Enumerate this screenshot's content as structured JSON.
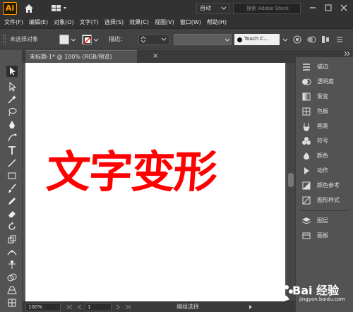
{
  "app": {
    "logo": "Ai",
    "accent": "#ff9a00"
  },
  "appbar": {
    "workspace": "自动",
    "search_placeholder": "搜索 Adobe Stock"
  },
  "menu": [
    "文件(F)",
    "编辑(E)",
    "对象(O)",
    "文字(T)",
    "选择(S)",
    "效果(C)",
    "视图(V)",
    "窗口(W)",
    "帮助(H)"
  ],
  "control_bar": {
    "selection_status": "未选择对象",
    "stroke_label": "描边：",
    "brush": "Touch C..."
  },
  "document": {
    "tab_title": "未标题-1* @ 100% (RGB/预览)",
    "close_glyph": "×",
    "artwork_text": "文字变形",
    "artwork_color": "#ff0000"
  },
  "status_bar": {
    "zoom": "100%",
    "page": "1",
    "status": "编组选择"
  },
  "tools": [
    "selection-tool",
    "direct-selection-tool",
    "magic-wand-tool",
    "lasso-tool",
    "pen-tool",
    "curvature-tool",
    "type-tool",
    "line-tool",
    "rectangle-tool",
    "paintbrush-tool",
    "pencil-tool",
    "eraser-tool",
    "rotate-tool",
    "scale-tool",
    "width-tool",
    "puppet-warp-tool",
    "shape-builder-tool",
    "perspective-tool",
    "mesh-tool"
  ],
  "panels": [
    {
      "label": "描边",
      "icon": "stroke-panel-icon"
    },
    {
      "label": "透明度",
      "icon": "transparency-panel-icon"
    },
    {
      "label": "渐变",
      "icon": "gradient-panel-icon"
    },
    {
      "label": "色板",
      "icon": "swatches-panel-icon"
    },
    {
      "label": "画笔",
      "icon": "brushes-panel-icon"
    },
    {
      "label": "符号",
      "icon": "symbols-panel-icon"
    },
    {
      "label": "颜色",
      "icon": "color-panel-icon"
    },
    {
      "label": "动作",
      "icon": "actions-panel-icon"
    },
    {
      "label": "颜色参考",
      "icon": "color-guide-panel-icon"
    },
    {
      "label": "图形样式",
      "icon": "graphic-styles-panel-icon"
    },
    {
      "label": "图层",
      "icon": "layers-panel-icon"
    },
    {
      "label": "画板",
      "icon": "artboards-panel-icon"
    }
  ],
  "watermark": {
    "text": "Bai 经验",
    "sub": "jingyan.baidu.com"
  }
}
